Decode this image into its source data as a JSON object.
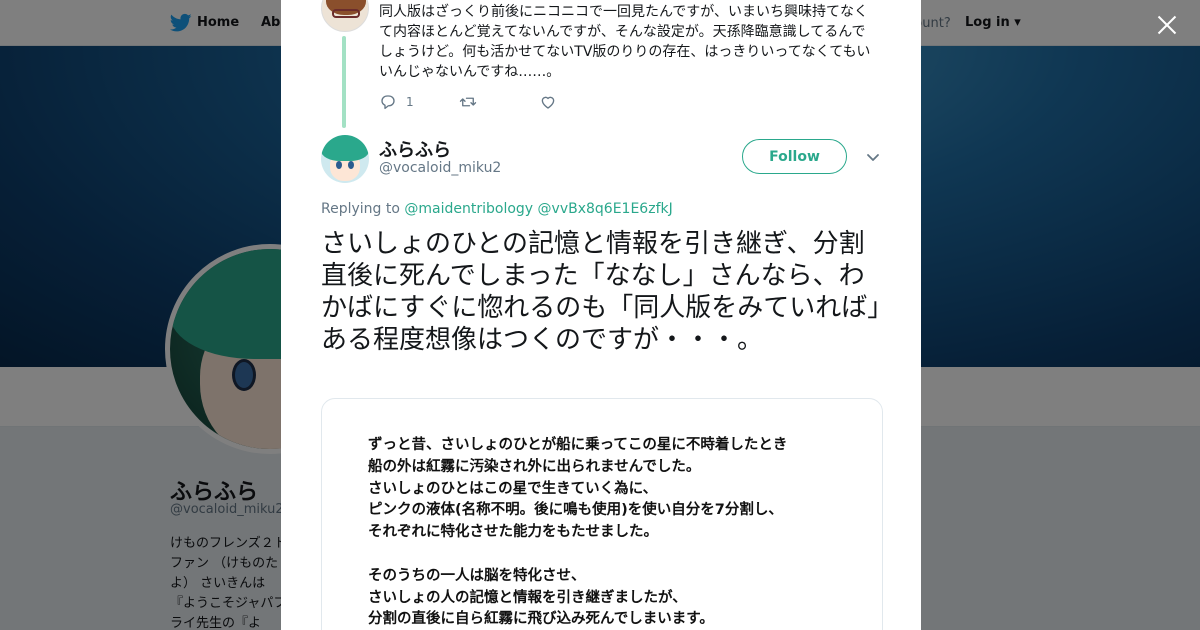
{
  "nav": {
    "home": "Home",
    "about": "Abo",
    "account_question": "ccount?",
    "login": "Log in"
  },
  "profile": {
    "name": "ふらふら",
    "handle": "@vocaloid_miku2",
    "bio": "けものフレンズ２トファン （けものたよ） さいきんは『ようこそジャパフライ先生の『よ"
  },
  "previous_tweet": {
    "text": "同人版はざっくり前後にニコニコで一回見たんですが、いまいち興味持てなくて内容ほとんど覚えてないんですが、そんな設定が。天孫降臨意識してるんでしょうけど。何も活かせてないTV版のりりの存在、はっきりいってなくてもいいんじゃないんですね……。",
    "reply_count": "1"
  },
  "tweet": {
    "author_name": "ふらふら",
    "author_handle": "@vocaloid_miku2",
    "follow_label": "Follow",
    "replying_label": "Replying to",
    "mention_1": "@maidentribology",
    "mention_2": "@vvBx8q6E1E6zfkJ",
    "text": "さいしょのひとの記憶と情報を引き継ぎ、分割直後に死んでしまった「ななし」さんなら、わかばにすぐに惚れるのも「同人版をみていれば」ある程度想像はつくのですが・・・。"
  },
  "media": {
    "lines": [
      "ずっと昔、さいしょのひとが船に乗ってこの星に不時着したとき",
      "船の外は紅霧に汚染され外に出られませんでした。",
      "さいしょのひとはこの星で生きていく為に、",
      "ピンクの液体(名称不明。後に鳴も使用)を使い自分を7分割し、",
      "それぞれに特化させた能力をもたせました。",
      "",
      "そのうちの一人は脳を特化させ、",
      "さいしょの人の記憶と情報を引き継ぎましたが、",
      "分割の直後に自ら紅霧に飛び込み死んでしまいます。"
    ]
  },
  "colors": {
    "accent": "#2aa88c",
    "thread_line": "#a3e1c4",
    "muted": "#657786",
    "twitter_blue": "#1da1f2"
  },
  "icons": {
    "logo": "bird-icon",
    "close": "close-icon",
    "reply": "reply-icon",
    "retweet": "retweet-icon",
    "like": "heart-icon",
    "more": "chevron-down-icon"
  }
}
